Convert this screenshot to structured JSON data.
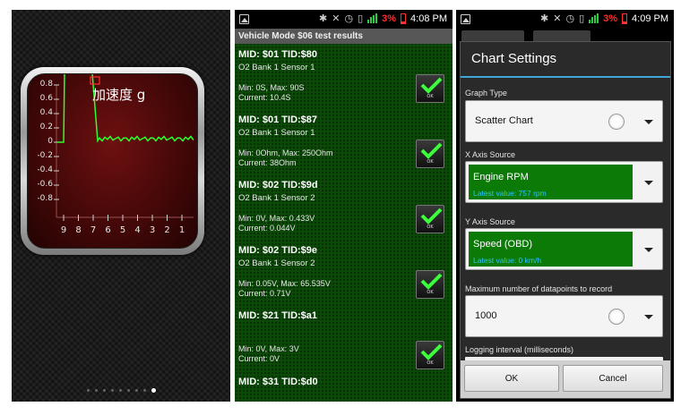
{
  "gauge": {
    "title": "加速度 g",
    "y_ticks": [
      "0.8",
      "0.6",
      "0.4",
      "0.2",
      "0",
      "-0.2",
      "-0.4",
      "-0.6",
      "-0.8"
    ],
    "x_ticks": [
      "9",
      "8",
      "7",
      "6",
      "5",
      "4",
      "3",
      "2",
      "1"
    ],
    "page_count": 9,
    "active_page": 8
  },
  "panel2": {
    "status_time": "4:08 PM",
    "battery": "3%",
    "header": "Vehicle Mode $06 test results",
    "ok_label": "OK",
    "results": [
      {
        "title": "MID: $01 TID:$80",
        "sensor": "O2 Bank 1 Sensor 1",
        "minmax": "Min: 0S, Max: 90S",
        "current": "Current: 10.4S"
      },
      {
        "title": "MID: $01 TID:$87",
        "sensor": "O2 Bank 1 Sensor 1",
        "minmax": "Min: 0Ohm, Max: 250Ohm",
        "current": "Current: 38Ohm"
      },
      {
        "title": "MID: $02 TID:$9d",
        "sensor": "O2 Bank 1 Sensor 2",
        "minmax": "Min: 0V, Max: 0.433V",
        "current": "Current: 0.044V"
      },
      {
        "title": "MID: $02 TID:$9e",
        "sensor": "O2 Bank 1 Sensor 2",
        "minmax": "Min: 0.05V, Max: 65.535V",
        "current": "Current: 0.71V"
      },
      {
        "title": "MID: $21 TID:$a1",
        "sensor": "",
        "minmax": "Min: 0V, Max: 3V",
        "current": "Current: 0V"
      },
      {
        "title": "MID: $31 TID:$d0",
        "sensor": "",
        "minmax": "",
        "current": ""
      }
    ]
  },
  "panel3": {
    "status_time": "4:09 PM",
    "battery": "3%",
    "dialog_title": "Chart Settings",
    "graph_type_label": "Graph Type",
    "graph_type_value": "Scatter Chart",
    "x_axis_label": "X Axis Source",
    "x_axis_value": "Engine RPM",
    "x_axis_latest": "Latest value: 757 rpm",
    "y_axis_label": "Y Axis Source",
    "y_axis_value": "Speed (OBD)",
    "y_axis_latest": "Latest value: 0 km/h",
    "max_points_label": "Maximum number of datapoints to record",
    "max_points_value": "1000",
    "logging_label": "Logging interval (milliseconds)",
    "ok_button": "OK",
    "cancel_button": "Cancel"
  },
  "colors": {
    "results_bg": "#0b4a07",
    "field_green": "#0b7a07",
    "latest_value_blue": "#2cc4ff",
    "battery_red": "#ff2a2a",
    "dialog_accent": "#3ea7d8",
    "trace_green": "#2cff2c"
  }
}
